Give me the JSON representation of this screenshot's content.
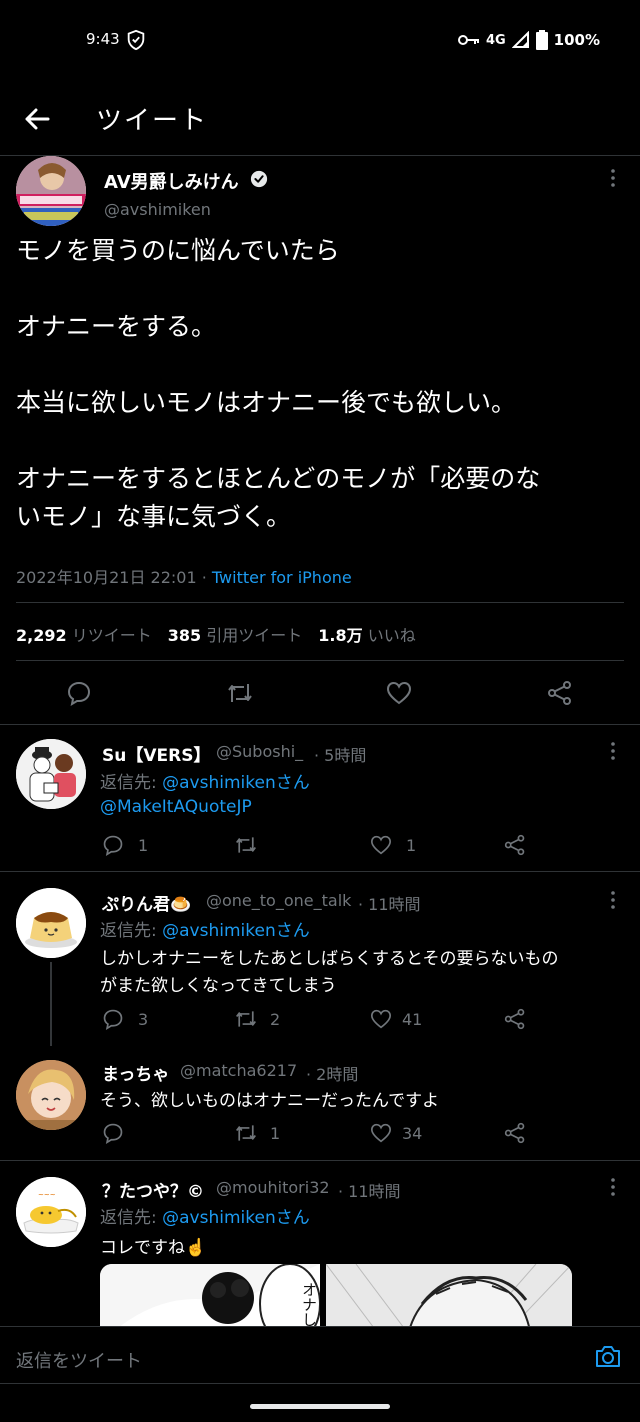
{
  "status_bar": {
    "time": "9:43",
    "network": "4G",
    "battery": "100%"
  },
  "header": {
    "title": "ツイート"
  },
  "main_tweet": {
    "name": "AV男爵しみけん",
    "handle": "@avshimiken",
    "lines": [
      "モノを買うのに悩んでいたら",
      "",
      "オナニーをする。",
      "",
      "本当に欲しいモノはオナニー後でも欲しい。",
      "",
      "オナニーをするとほとんどのモノが「必要のな",
      "いモノ」な事に気づく。"
    ],
    "timestamp": "2022年10月21日 22:01 · ",
    "source": "Twitter for iPhone",
    "stats": {
      "retweets_count": "2,292",
      "retweets_label": "リツイート",
      "quotes_count": "385",
      "quotes_label": "引用ツイート",
      "likes_count": "1.8万",
      "likes_label": "いいね"
    }
  },
  "replies": [
    {
      "name": "Su【VERS】",
      "handle": "@Suboshi_",
      "time": "· 5時間",
      "reply_prefix": "返信先: ",
      "reply_to": "@avshimikenさん",
      "reply_to_2": "@MakeItAQuoteJP",
      "text": "",
      "reply_count": "1",
      "retweet_count": "",
      "like_count": "1"
    },
    {
      "name": "ぷりん君🍮",
      "handle": "@one_to_one_talk",
      "time": "· 11時間",
      "reply_prefix": "返信先: ",
      "reply_to": "@avshimikenさん",
      "text_1": "しかしオナニーをしたあとしばらくするとその要らないもの",
      "text_2": "がまた欲しくなってきてしまう",
      "reply_count": "3",
      "retweet_count": "2",
      "like_count": "41"
    },
    {
      "name": "まっちゃ",
      "handle": "@matcha6217",
      "time": "· 2時間",
      "text": "そう、欲しいものはオナニーだったんですよ",
      "reply_count": "",
      "retweet_count": "1",
      "like_count": "34"
    },
    {
      "name": "？たつや？©",
      "handle": "@mouhitori32",
      "time": "· 11時間",
      "reply_prefix": "返信先: ",
      "reply_to": "@avshimikenさん",
      "text": "コレですね☝️",
      "manga_text": "オナした"
    }
  ],
  "reply_bar": {
    "placeholder": "返信をツイート"
  },
  "colors": {
    "accent": "#1d9bf0",
    "muted": "#71767b",
    "background": "#000000"
  }
}
